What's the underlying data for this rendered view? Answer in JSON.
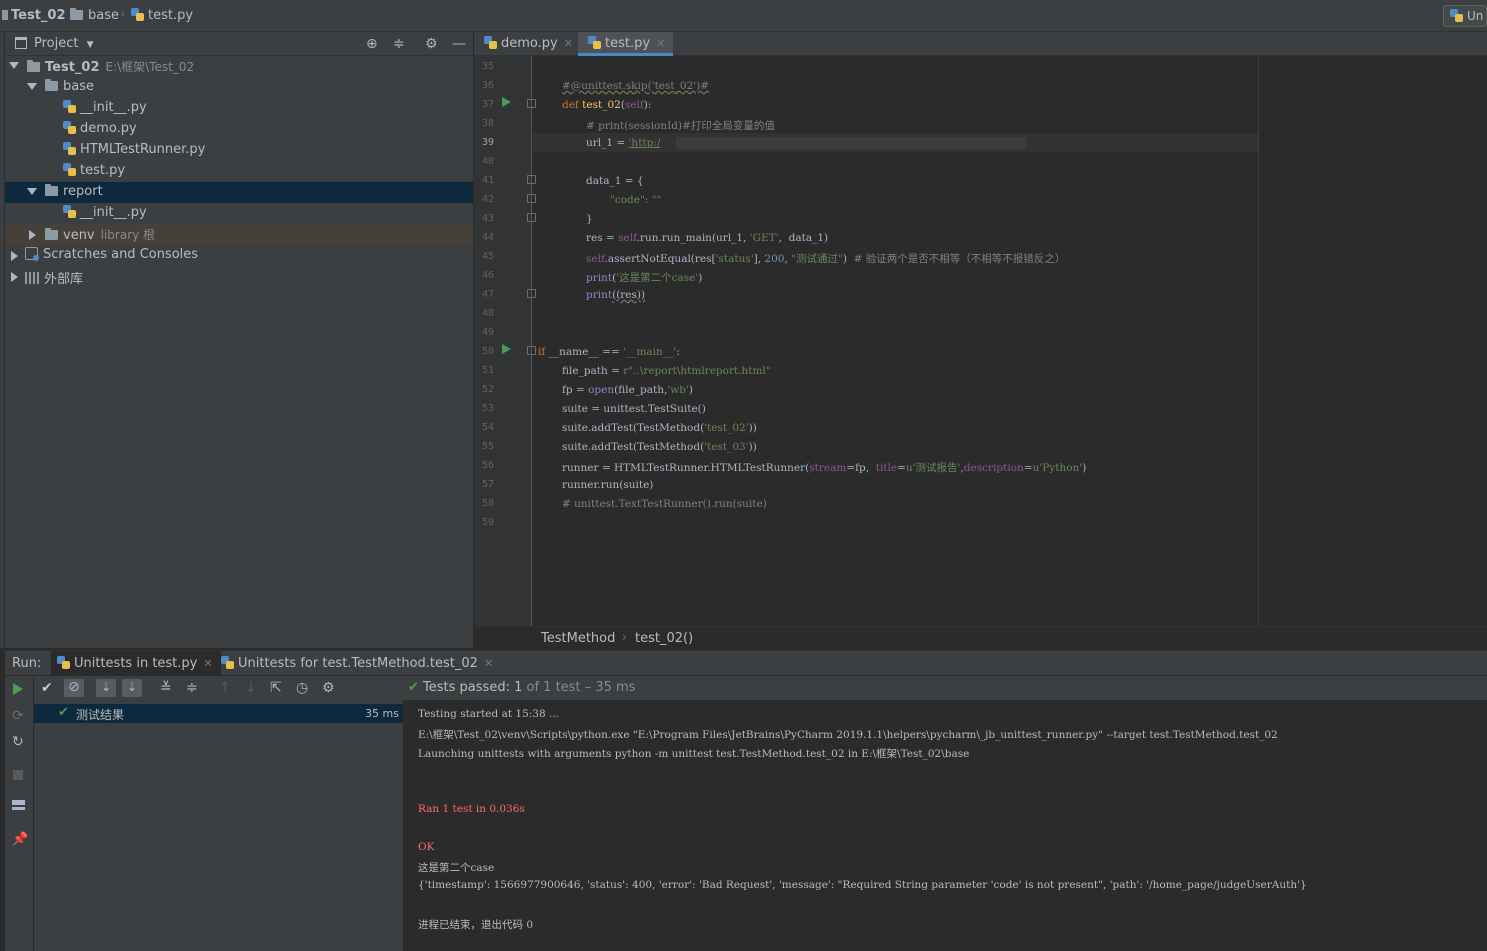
{
  "breadcrumb": {
    "project": "Test_02",
    "folder": "base",
    "file": "test.py"
  },
  "run_config": {
    "label": "Un"
  },
  "project_panel": {
    "title": "Project",
    "tree": [
      {
        "label": "Test_02",
        "hint": "E:\\框架\\Test_02"
      },
      {
        "label": "base"
      },
      {
        "label": "__init__.py"
      },
      {
        "label": "demo.py"
      },
      {
        "label": "HTMLTestRunner.py"
      },
      {
        "label": "test.py"
      },
      {
        "label": "report"
      },
      {
        "label": "__init__.py"
      },
      {
        "label": "venv",
        "hint": "library 根"
      },
      {
        "label": "Scratches and Consoles"
      },
      {
        "label": "外部库"
      }
    ]
  },
  "editor_tabs": [
    {
      "label": "demo.py"
    },
    {
      "label": "test.py"
    }
  ],
  "line_numbers": [
    "35",
    "36",
    "37",
    "38",
    "39",
    "40",
    "41",
    "42",
    "43",
    "44",
    "45",
    "46",
    "47",
    "48",
    "49",
    "50",
    "51",
    "52",
    "53",
    "54",
    "55",
    "56",
    "57",
    "58",
    "59"
  ],
  "code": {
    "l36": "#@unittest.skip('test_02')#",
    "l37_kw": "def ",
    "l37_fn": "test_02",
    "l37_a": "(",
    "l37_self": "self",
    "l37_b": "):",
    "l38": "# print(sessionId)#打印全局变量的值",
    "l39_a": "url_1 = ",
    "l39_s": "'http:/",
    "l41": "data_1 = {",
    "l42_s": "\"code\"",
    "l42_a": ": ",
    "l42_b": "\"\"",
    "l43": "}",
    "l44_a": "res = ",
    "l44_self": "self",
    "l44_b": ".run.run_main(url_1, ",
    "l44_s": "'GET'",
    "l44_c": ",  data_1)",
    "l45_self": "self",
    "l45_a": ".assertNotEqual(res[",
    "l45_s1": "'status'",
    "l45_b": "], ",
    "l45_n": "200",
    "l45_c": ", ",
    "l45_s2": "\"测试通过\"",
    "l45_d": ")  ",
    "l45_cm": "# 验证两个是否不相等（不相等不报错反之）",
    "l46_b": "print",
    "l46_a": "(",
    "l46_s": "'这是第二个case'",
    "l46_c": ")",
    "l47_b": "print",
    "l47_a": "((res))",
    "l50_k": "if ",
    "l50_a": "__name__ == ",
    "l50_s": "'__main__'",
    "l50_b": ":",
    "l51_a": "file_path = ",
    "l51_s": "r\"..\\report\\htmlreport.html\"",
    "l52_a": "fp = ",
    "l52_b": "open",
    "l52_c": "(file_path,",
    "l52_s": "'wb'",
    "l52_d": ")",
    "l53": "suite = unittest.TestSuite()",
    "l54_a": "suite.addTest(TestMethod(",
    "l54_s": "'test_02'",
    "l54_b": "))",
    "l55_a": "suite.addTest(TestMethod(",
    "l55_s": "'test_03'",
    "l55_b": "))",
    "l56_a": "runner = HTMLTestRunner.HTMLTestRunner(",
    "l56_p1": "stream",
    "l56_b": "=fp,  ",
    "l56_p2": "title",
    "l56_c": "=",
    "l56_s1": "u'测试报告'",
    "l56_d": ",",
    "l56_p3": "description",
    "l56_e": "=",
    "l56_s2": "u'Python'",
    "l56_f": ")",
    "l57": "runner.run(suite)",
    "l58": "# unittest.TextTestRunner().run(suite)"
  },
  "editor_breadcrumb": {
    "cls": "TestMethod",
    "method": "test_02()"
  },
  "run_panel": {
    "run_label": "Run:",
    "tabs": [
      {
        "label": "Unittests in test.py"
      },
      {
        "label": "Unittests for test.TestMethod.test_02"
      }
    ],
    "status_prefix": "Tests passed:",
    "status_count": "1",
    "status_of": "of 1 test",
    "status_time": "– 35 ms",
    "test_tree": [
      {
        "label": "测试结果",
        "time": "35 ms"
      }
    ]
  },
  "console_lines": [
    "Testing started at 15:38 ...",
    "E:\\框架\\Test_02\\venv\\Scripts\\python.exe \"E:\\Program Files\\JetBrains\\PyCharm 2019.1.1\\helpers\\pycharm\\_jb_unittest_runner.py\" --target test.TestMethod.test_02",
    "Launching unittests with arguments python -m unittest test.TestMethod.test_02 in E:\\框架\\Test_02\\base",
    "Ran 1 test in 0.036s",
    "OK",
    "这是第二个case",
    "{'timestamp': 1566977900646, 'status': 400, 'error': 'Bad Request', 'message': \"Required String parameter 'code' is not present\", 'path': '/home_page/judgeUserAuth'}",
    "进程已结束，退出代码 0"
  ],
  "colors": {
    "selection": "#0d293e",
    "accent": "#4a88c7",
    "pass": "#499c54",
    "error": "#ff6b68"
  }
}
